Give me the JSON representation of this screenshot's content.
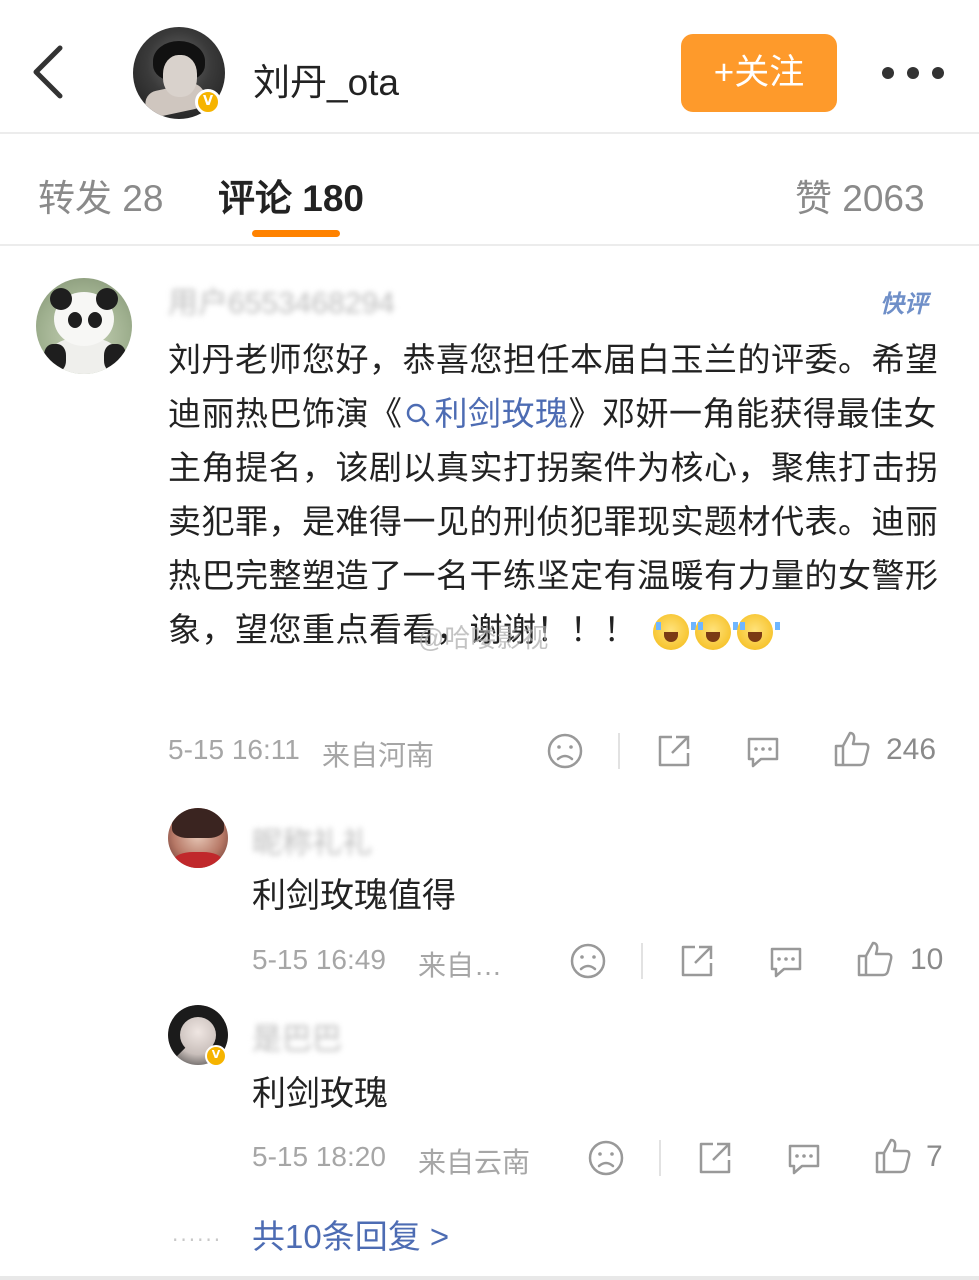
{
  "header": {
    "username": "刘丹_ota",
    "follow_label": "+关注",
    "verified_mark": "V",
    "colors": {
      "follow_bg": "#fe9a2b",
      "verified": "#f6b400"
    }
  },
  "tabs": [
    {
      "label": "转发 28"
    },
    {
      "label": "评论 180"
    },
    {
      "label": "赞 2063"
    }
  ],
  "active_tab_color": "#ff8200",
  "comment": {
    "username": "用户6553468294",
    "tag": "快评",
    "text_before_link": "刘丹老师您好，恭喜您担任本届白玉兰的评委。希望迪丽热巴饰演《",
    "link_icon": "search-icon",
    "link_text": "利剑玫瑰",
    "text_after_link": "》邓妍一角能获得最佳女主角提名，该剧以真实打拐案件为核心，聚焦打击拐卖犯罪，是难得一见的刑侦犯罪现实题材代表。迪丽热巴完整塑造了一名干练坚定有温暖有力量的女警形象，望您重点看看，谢谢！！！",
    "emojis": [
      "crying-laugh-emoji",
      "crying-laugh-emoji",
      "crying-laugh-emoji"
    ],
    "watermark": "@哈喽影视",
    "time": "5-15 16:11",
    "location": "来自河南",
    "likes": "246"
  },
  "replies": [
    {
      "username": "昵称礼礼",
      "text": "利剑玫瑰值得",
      "time": "5-15 16:49",
      "location": "来自…",
      "likes": "10"
    },
    {
      "username": "是巴巴",
      "text": "利剑玫瑰",
      "time": "5-15 18:20",
      "location": "来自云南",
      "likes": "7"
    }
  ],
  "more_replies": "共10条回复 >",
  "link_color": "#4d6cb3"
}
